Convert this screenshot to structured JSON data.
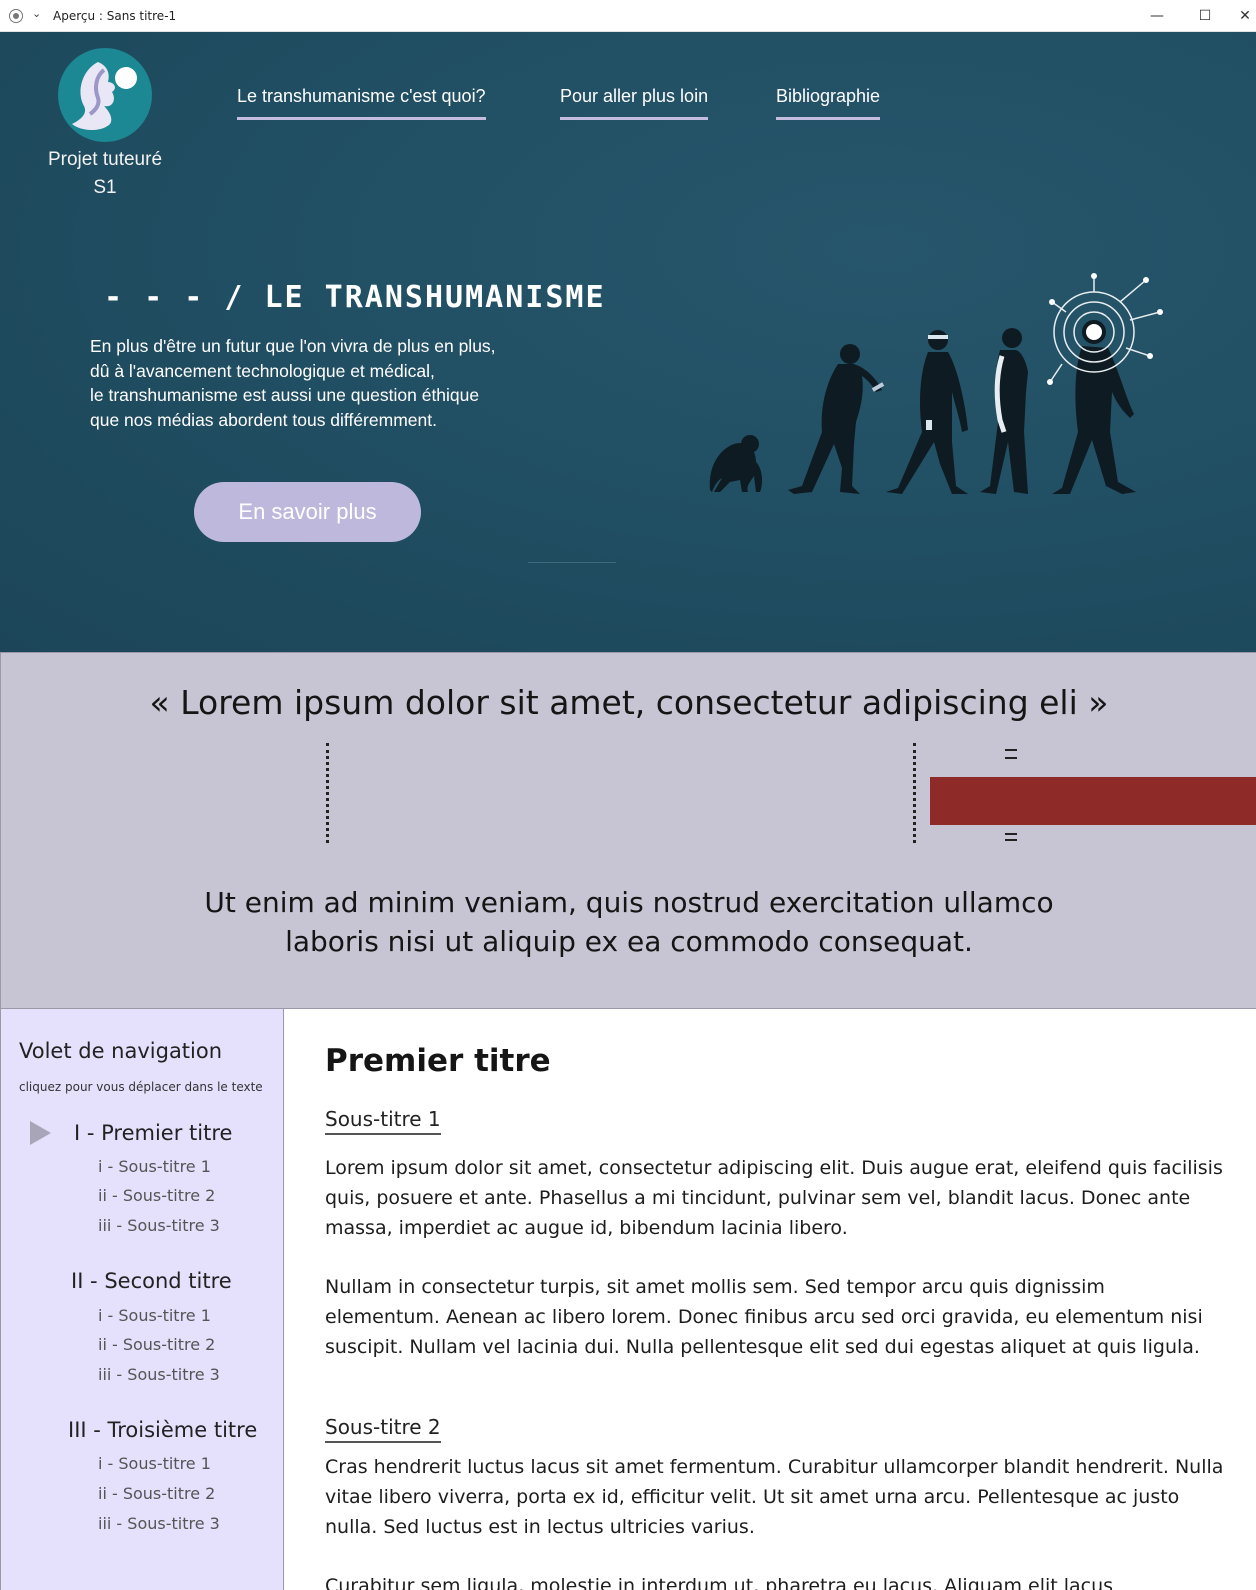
{
  "window": {
    "title": "Aperçu : Sans titre-1",
    "minimize_glyph": "—",
    "maximize_glyph": "☐",
    "close_glyph": "✕"
  },
  "header": {
    "logo_caption_line1": "Projet tuteuré",
    "logo_caption_line2": "S1",
    "nav": [
      {
        "label": "Le transhumanisme c'est quoi?"
      },
      {
        "label": "Pour aller plus loin"
      },
      {
        "label": "Bibliographie"
      }
    ]
  },
  "hero": {
    "title": "- - - / LE TRANSHUMANISME",
    "text_lines": [
      "En plus d'être un futur que l'on vivra de plus en plus,",
      "dû à l'avancement technologique et médical,",
      "le transhumanisme est aussi une question éthique",
      "que nos médias abordent tous différemment."
    ],
    "cta_label": "En savoir plus"
  },
  "quote": {
    "text": "« Lorem ipsum dolor sit amet, consectetur adipiscing eli »",
    "sub_line1": "Ut enim ad minim veniam, quis nostrud exercitation ullamco",
    "sub_line2": "laboris nisi ut aliquip ex ea commodo consequat."
  },
  "sidebar": {
    "title": "Volet de navigation",
    "subtitle": "cliquez pour vous déplacer dans le texte",
    "sections": [
      {
        "label": "I  -  Premier titre",
        "items": [
          "i  -  Sous-titre 1",
          "ii  -  Sous-titre 2",
          "iii - Sous-titre 3"
        ]
      },
      {
        "label": "II  -  Second titre",
        "items": [
          "i  -  Sous-titre 1",
          "ii  -  Sous-titre 2",
          "iii - Sous-titre 3"
        ]
      },
      {
        "label": "III -  Troisième titre",
        "items": [
          "i  -  Sous-titre 1",
          "ii  -  Sous-titre 2",
          "iii - Sous-titre 3"
        ]
      }
    ]
  },
  "content": {
    "title": "Premier titre",
    "sub1": "Sous-titre 1",
    "p1": "Lorem ipsum dolor sit amet, consectetur adipiscing elit. Duis augue erat, eleifend quis facilisis quis, posuere et ante. Phasellus a mi tincidunt, pulvinar sem vel, blandit lacus. Donec ante massa, imperdiet ac augue id, bibendum lacinia libero.",
    "p2": "Nullam in consectetur turpis, sit amet mollis sem. Sed tempor arcu quis dignissim elementum. Aenean ac libero lorem. Donec finibus arcu sed orci gravida, eu elementum nisi suscipit. Nullam vel lacinia dui. Nulla pellentesque elit sed dui egestas aliquet at quis ligula.",
    "sub2": "Sous-titre 2",
    "p3": "Cras hendrerit luctus lacus sit amet fermentum. Curabitur ullamcorper blandit hendrerit. Nulla vitae libero viverra, porta ex id, efficitur velit. Ut sit amet urna arcu. Pellentesque ac justo nulla. Sed luctus est in lectus ultricies varius.",
    "p4": "Curabitur sem ligula, molestie in interdum ut, pharetra eu lacus. Aliquam elit lacus"
  },
  "colors": {
    "hero_bg": "#214f63",
    "nav_underline": "#c4bde0",
    "cta_bg": "#beb8dd",
    "quote_bg": "#c7c5d3",
    "red_bar": "#8e2a28",
    "sidebar_bg": "#e5e0fb"
  }
}
